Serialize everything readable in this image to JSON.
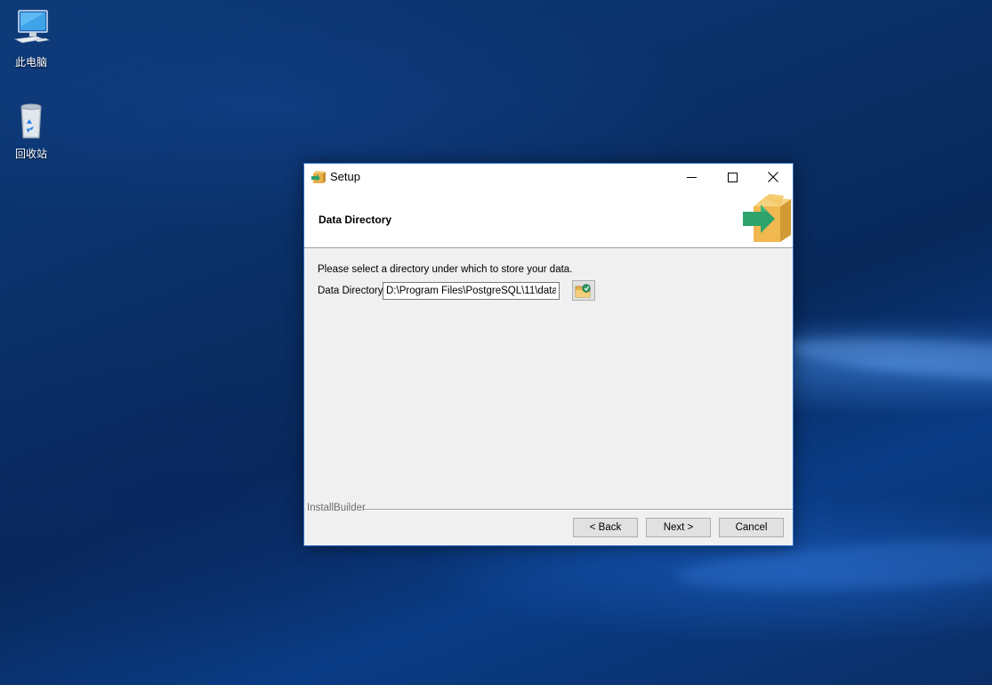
{
  "desktop": {
    "icons": [
      {
        "label": "此电脑",
        "icon": "computer-icon"
      },
      {
        "label": "回收站",
        "icon": "recycle-bin-icon"
      }
    ]
  },
  "window": {
    "title": "Setup",
    "app_icon": "installer-box-icon",
    "controls": {
      "minimize": "minimize-icon",
      "maximize": "maximize-icon",
      "close": "close-icon"
    }
  },
  "header": {
    "title": "Data Directory",
    "logo_icon": "installer-box-arrow-icon"
  },
  "content": {
    "instruction": "Please select a directory under which to store your data.",
    "field_label": "Data Directory",
    "field_value": "D:\\Program Files\\PostgreSQL\\11\\data",
    "browse_icon": "browse-folder-icon"
  },
  "footer": {
    "brand": "InstallBuilder",
    "back_label": "< Back",
    "next_label": "Next >",
    "cancel_label": "Cancel"
  },
  "colors": {
    "dialog_border": "#2b6cc9",
    "dialog_bg": "#f0f0f0",
    "desktop_bg": "#0a2f66"
  }
}
